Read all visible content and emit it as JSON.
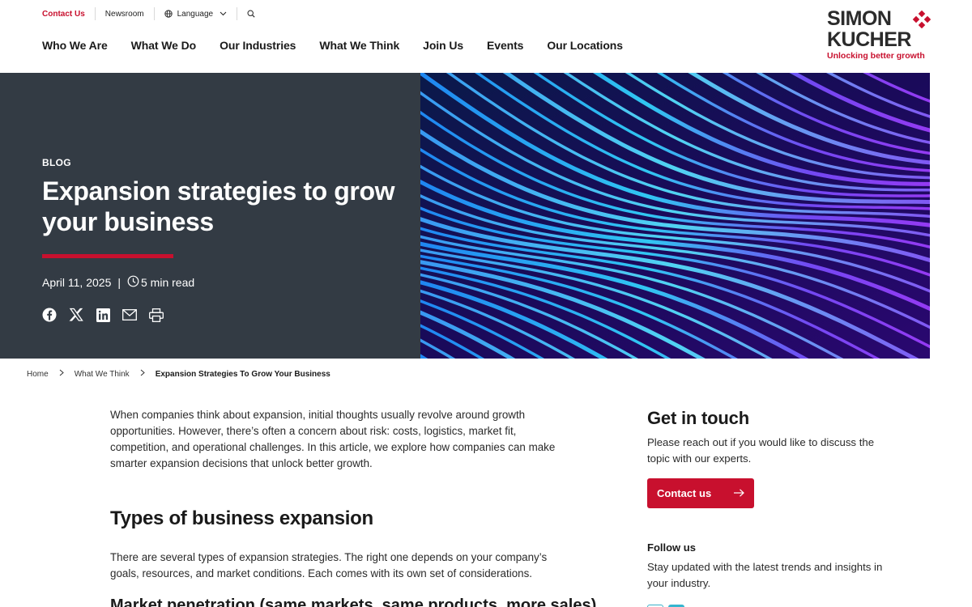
{
  "topbar": {
    "contact": "Contact Us",
    "newsroom": "Newsroom",
    "language": "Language"
  },
  "nav": {
    "items": [
      "Who We Are",
      "What We Do",
      "Our Industries",
      "What We Think",
      "Join Us",
      "Events",
      "Our Locations"
    ]
  },
  "logo": {
    "line1": "SIMON",
    "line2": "KUCHER",
    "tagline": "Unlocking better growth"
  },
  "hero": {
    "kicker": "BLOG",
    "title": "Expansion strategies to grow your business",
    "date": "April 11, 2025",
    "separator": "|",
    "read_time": "5 min read",
    "share_icons": [
      "facebook-icon",
      "x-icon",
      "linkedin-icon",
      "email-icon",
      "print-icon"
    ]
  },
  "breadcrumb": {
    "home": "Home",
    "section": "What We Think",
    "current": "Expansion Strategies To Grow Your Business"
  },
  "article": {
    "intro": "When companies think about expansion, initial thoughts usually revolve around growth opportunities. However, there’s often a concern about risk: costs, logistics, market fit, competition, and operational challenges. In this article, we explore how companies can make smarter expansion decisions that unlock better growth.",
    "heading": "Types of business expansion",
    "para2": "There are several types of expansion strategies. The right one depends on your company’s goals, resources, and market conditions. Each comes with its own set of considerations.",
    "next_heading": "Market penetration (same markets, same products, more sales)"
  },
  "sidebar": {
    "title": "Get in touch",
    "text": "Please reach out if you would like to discuss the topic with our experts.",
    "button": "Contact us",
    "follow_title": "Follow us",
    "follow_text": "Stay updated with the latest trends and insights in your industry."
  },
  "colors": {
    "accent": "#c8102e",
    "hero_bg": "#333b44",
    "text": "#1a1a1a"
  }
}
